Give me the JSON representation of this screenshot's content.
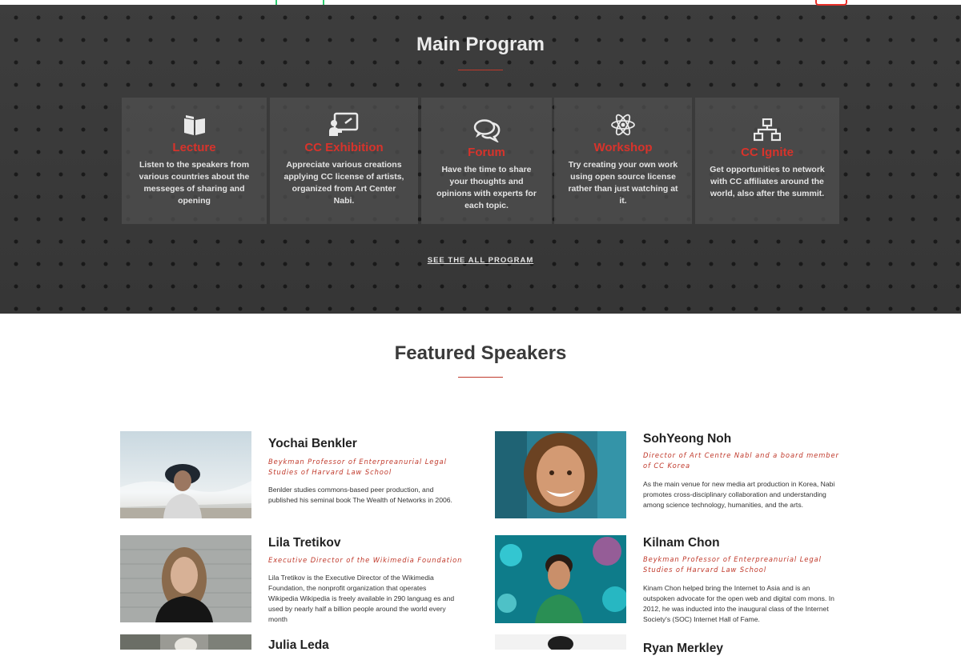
{
  "colors": {
    "accent": "#d8332b",
    "dark_section": "#3a3a3a",
    "nav_green": "#2ecc71"
  },
  "program": {
    "title": "Main Program",
    "cards": [
      {
        "icon": "book-icon",
        "title": "Lecture",
        "desc": "Listen to the speakers from various countries about the messeges of sharing and opening"
      },
      {
        "icon": "presentation-icon",
        "title": "CC Exhibition",
        "desc": "Appreciate various creations applying CC license of artists, organized from Art Center Nabi."
      },
      {
        "icon": "chat-bubbles-icon",
        "title": "Forum",
        "desc": "Have the time to share your thoughts and opinions with experts for each topic."
      },
      {
        "icon": "atom-icon",
        "title": "Workshop",
        "desc": "Try creating your own work using open source license rather than just watching at it."
      },
      {
        "icon": "network-icon",
        "title": "CC Ignite",
        "desc": "Get opportunities to network with CC affiliates around the world, also after the summit."
      }
    ],
    "see_all": "SEE THE ALL PROGRAM"
  },
  "speakers": {
    "title": "Featured Speakers",
    "items": [
      {
        "name": "Yochai Benkler",
        "role": "Beykman Professor of Enterpreanurial Legal Studies of Harvard Law School",
        "bio": "Benlder studies commons-based peer production, and published his seminal book The Wealth of Networks in 2006."
      },
      {
        "name": "SohYeong Noh",
        "role": "Director of Art Centre Nabl and a board member of CC Korea",
        "bio": "As the main venue for new media art production in Korea, Nabi promotes cross-disciplinary collaboration and understanding among science technology, humanities, and the arts."
      },
      {
        "name": "Lila Tretikov",
        "role": "Executive Director of the Wikimedia Foundation",
        "bio": "Lila Tretikov is the Executive Director of the Wikimedia Foundation, the nonprofit organization that operates Wikipedia Wikipedia is freely available in 290 languag es and used by nearly half a billion people around the world every month"
      },
      {
        "name": "Kilnam Chon",
        "role": "Beykman Professor of Enterpreanurial Legal Studies of Harvard Law School",
        "bio": "Kinam Chon helped bring the Internet to Asia and is an outspoken advocate for the open web and digital com mons. In 2012, he was inducted into the inaugural class of the Internet Society's (SOC) Internet Hall of Fame."
      },
      {
        "name": "Julia Leda",
        "role": "",
        "bio": ""
      },
      {
        "name": "Ryan Merkley",
        "role": "",
        "bio": ""
      }
    ]
  }
}
